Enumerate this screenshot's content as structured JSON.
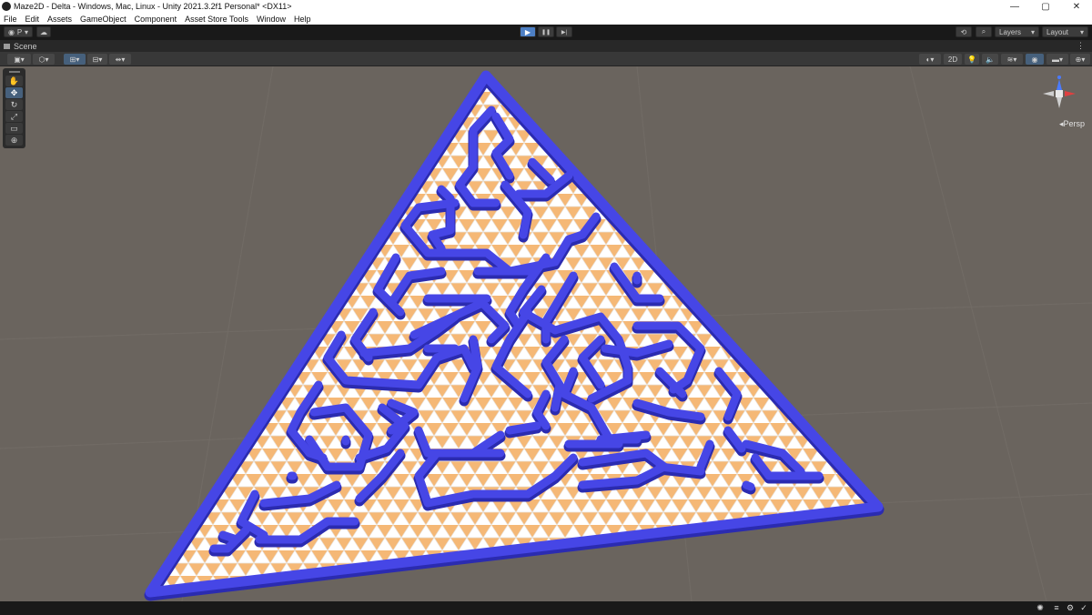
{
  "window": {
    "title": "Maze2D - Delta - Windows, Mac, Linux - Unity 2021.3.2f1 Personal* <DX11>",
    "controls": [
      "—",
      "▢",
      "✕"
    ]
  },
  "menu": [
    "File",
    "Edit",
    "Assets",
    "GameObject",
    "Component",
    "Asset Store Tools",
    "Window",
    "Help"
  ],
  "toolbar": {
    "account_label": "P",
    "layers_label": "Layers",
    "layout_label": "Layout",
    "play_icon": "▶",
    "pause_icon": "❚❚",
    "step_icon": "▶|"
  },
  "scene": {
    "tab_label": "Scene",
    "more": "⋮",
    "mode_2d": "2D",
    "persp_label": "Persp"
  },
  "colors": {
    "wall": "#4646e6",
    "wall_dark": "#2b2bb0",
    "tile_orange": "#f5b876",
    "tile_white": "#ffffff",
    "background": "#6a645e",
    "play_blue": "#4d7fc4"
  },
  "icons": {
    "tools": [
      "hand-icon",
      "move-icon",
      "rotate-icon",
      "scale-icon",
      "rect-icon",
      "transform-icon"
    ],
    "tool_glyphs": [
      "✋",
      "✥",
      "↻",
      "⤢",
      "▭",
      "⊕"
    ]
  }
}
